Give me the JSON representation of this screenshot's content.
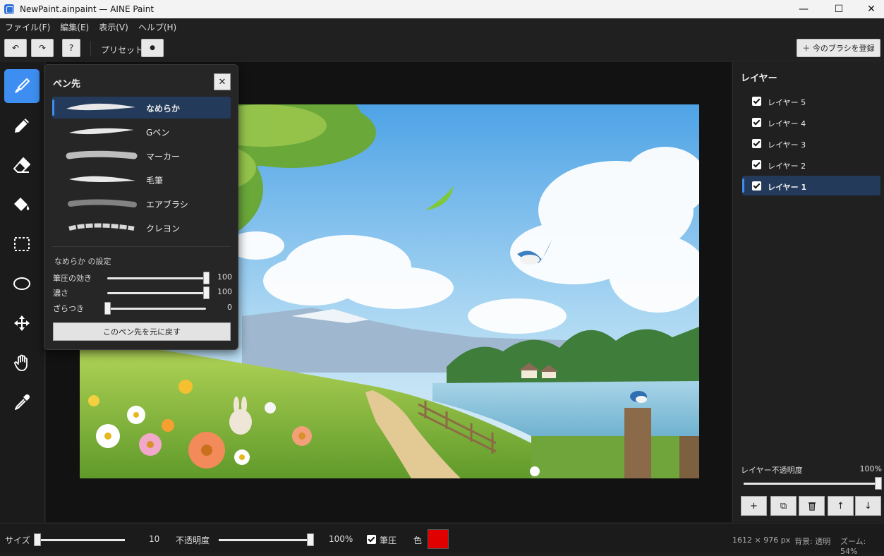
{
  "window": {
    "title": "NewPaint.ainpaint — AINE Paint",
    "minimize": "—",
    "maximize": "☐",
    "close": "✕"
  },
  "menu": [
    "ファイル(F)",
    "編集(E)",
    "表示(V)",
    "ヘルプ(H)"
  ],
  "toolbar": {
    "undo": "↶",
    "redo": "↷",
    "help": "?",
    "preset_label": "プリセット",
    "preset_dot": "●",
    "register_brush": "＋ 今のブラシを登録"
  },
  "tools": [
    {
      "name": "brush",
      "icon": "brush-icon",
      "active": true
    },
    {
      "name": "pencil",
      "icon": "pencil-icon",
      "active": false
    },
    {
      "name": "eraser",
      "icon": "eraser-icon",
      "active": false
    },
    {
      "name": "fill",
      "icon": "paint-bucket-icon",
      "active": false
    },
    {
      "name": "rect-select",
      "icon": "rect-select-icon",
      "active": false
    },
    {
      "name": "ellipse-select",
      "icon": "ellipse-select-icon",
      "active": false
    },
    {
      "name": "move",
      "icon": "move-icon",
      "active": false
    },
    {
      "name": "hand",
      "icon": "hand-icon",
      "active": false
    },
    {
      "name": "eyedropper",
      "icon": "eyedropper-icon",
      "active": false
    }
  ],
  "pen_panel": {
    "title": "ペン先",
    "close": "✕",
    "tips": [
      {
        "label": "なめらか",
        "selected": true
      },
      {
        "label": "Gペン",
        "selected": false
      },
      {
        "label": "マーカー",
        "selected": false
      },
      {
        "label": "毛筆",
        "selected": false
      },
      {
        "label": "エアブラシ",
        "selected": false
      },
      {
        "label": "クレヨン",
        "selected": false
      }
    ],
    "settings_title": "なめらか の設定",
    "settings": [
      {
        "label": "筆圧の効き",
        "value": "100",
        "fraction": 1.0
      },
      {
        "label": "濃さ",
        "value": "100",
        "fraction": 1.0
      },
      {
        "label": "ざらつき",
        "value": "0",
        "fraction": 0.0
      }
    ],
    "reset_button": "このペン先を元に戻す"
  },
  "layers_panel": {
    "title": "レイヤー",
    "layers": [
      {
        "name": "レイヤー 5",
        "visible": true,
        "selected": false
      },
      {
        "name": "レイヤー 4",
        "visible": true,
        "selected": false
      },
      {
        "name": "レイヤー 3",
        "visible": true,
        "selected": false
      },
      {
        "name": "レイヤー 2",
        "visible": true,
        "selected": false
      },
      {
        "name": "レイヤー 1",
        "visible": true,
        "selected": true
      }
    ],
    "opacity_label": "レイヤー不透明度",
    "opacity_value": "100%",
    "opacity_fraction": 1.0,
    "buttons": [
      "+",
      "⧉",
      "🗑",
      "↑",
      "↓"
    ]
  },
  "statusbar": {
    "size_label": "サイズ",
    "size_value": "10",
    "size_fraction": 0.0,
    "opacity_label": "不透明度",
    "opacity_value": "100%",
    "opacity_fraction": 1.0,
    "pressure_label": "筆圧",
    "pressure_checked": true,
    "color_label": "色",
    "color": "#e00000",
    "canvas_size": "1612 × 976 px",
    "background": "背景: 透明",
    "zoom": "ズーム: 54%"
  },
  "colors": {
    "accent": "#3d8ef0",
    "selected_row": "#233a5a"
  }
}
